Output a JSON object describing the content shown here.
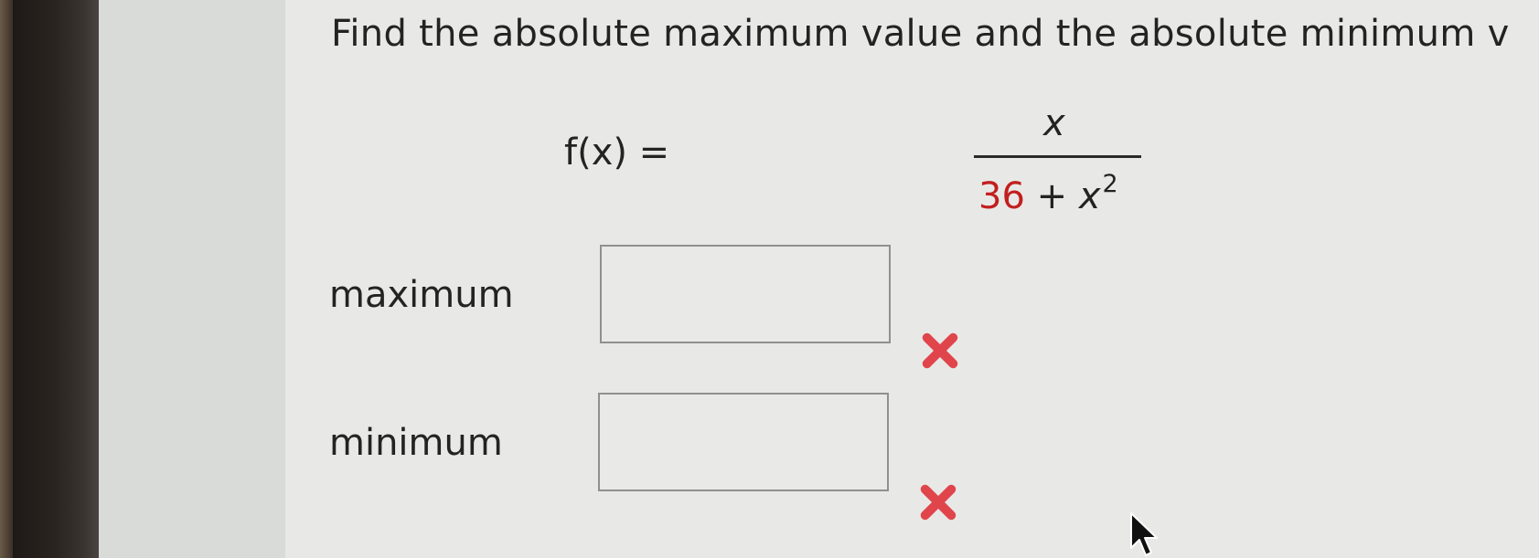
{
  "question": {
    "text": "Find the absolute maximum value and the absolute minimum v"
  },
  "formula": {
    "lhs": "f(x) =",
    "numerator": "x",
    "denominator_constant": "36",
    "denominator_plus": "+",
    "denominator_var": "x",
    "denominator_exponent": "2"
  },
  "answers": [
    {
      "label": "maximum",
      "value": "",
      "status": "incorrect"
    },
    {
      "label": "minimum",
      "value": "",
      "status": "incorrect"
    }
  ],
  "colors": {
    "highlight_red": "#c21f1f",
    "wrong_mark": "#e0454c"
  },
  "icons": {
    "wrong": "x-mark-icon",
    "cursor": "mouse-pointer-icon"
  }
}
